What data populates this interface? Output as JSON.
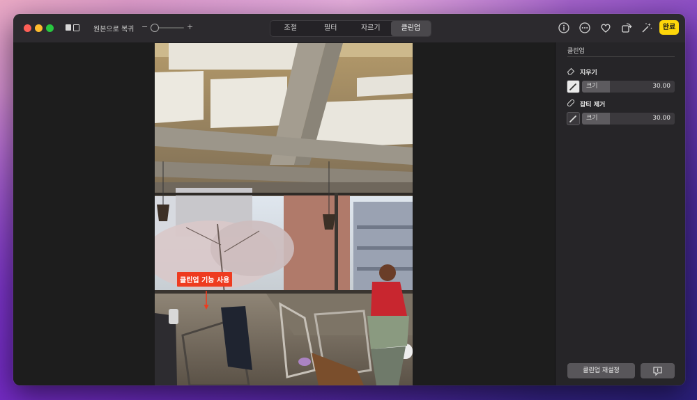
{
  "toolbar": {
    "revert_label": "원본으로 복귀",
    "zoom_minus": "−",
    "zoom_plus": "+",
    "zoom_level": 0.05,
    "tabs": [
      {
        "label": "조절",
        "active": false
      },
      {
        "label": "필터",
        "active": false
      },
      {
        "label": "자르기",
        "active": false
      },
      {
        "label": "클린업",
        "active": true
      }
    ],
    "icons": [
      "info-icon",
      "more-icon",
      "heart-icon",
      "rotate-icon",
      "magic-wand-icon"
    ],
    "done_label": "완료",
    "accent_color": "#fdd60a"
  },
  "photo": {
    "annotation_text": "클린업 기능 사용",
    "annotation_color": "#ee3b1f"
  },
  "sidebar": {
    "title": "클린업",
    "tools": [
      {
        "label": "지우기",
        "icon": "eraser-icon",
        "size_label": "크기",
        "size_value": "30.00",
        "size_fraction": 0.3
      },
      {
        "label": "잡티 제거",
        "icon": "bandage-icon",
        "size_label": "크기",
        "size_value": "30.00",
        "size_fraction": 0.3
      }
    ],
    "reset_label": "클린업 재설정",
    "feedback_icon": "feedback-icon"
  }
}
